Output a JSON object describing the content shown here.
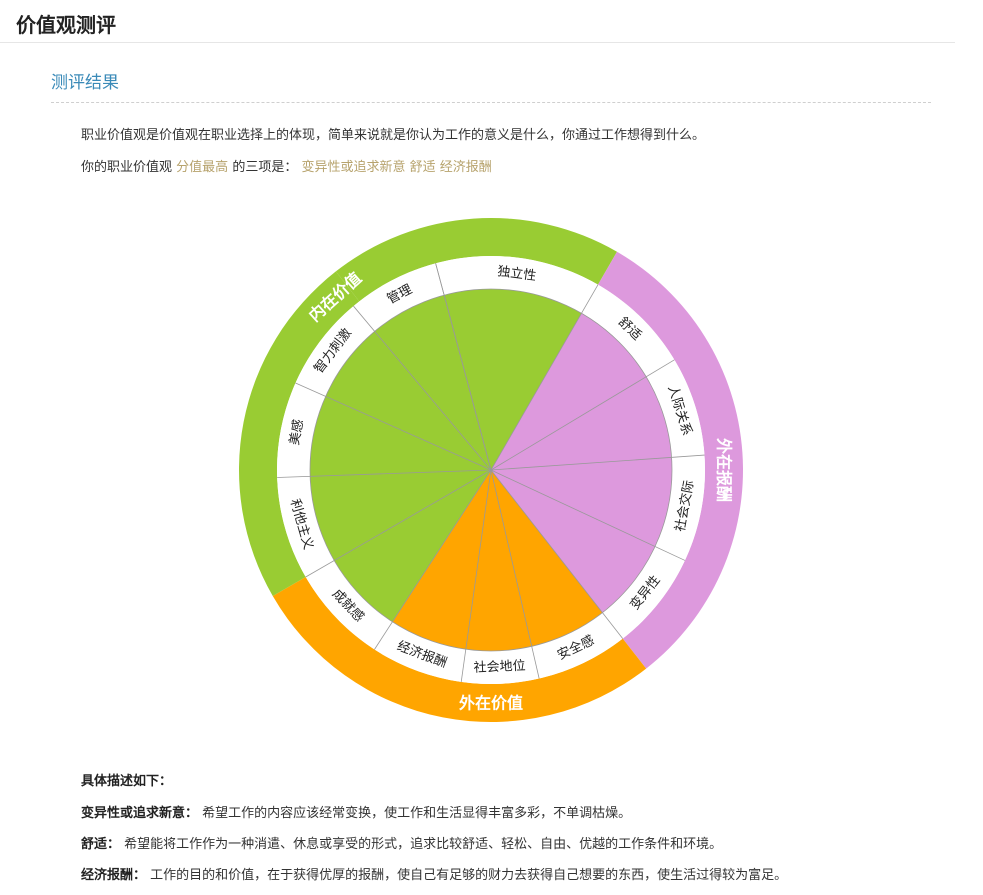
{
  "header": {
    "title": "价值观测评"
  },
  "section": {
    "title": "测评结果"
  },
  "intro": {
    "line1": "职业价值观是价值观在职业选择上的体现，简单来说就是你认为工作的意义是什么，你通过工作想得到什么。",
    "line2_prefix": "你的职业价值观",
    "line2_highlight": "分值最高",
    "line2_middle": "的三项是：",
    "line2_top3": "变异性或追求新意 舒适 经济报酬"
  },
  "wheel": {
    "colors": {
      "intrinsic": "#99cc33",
      "extrinsic_reward": "#dd99dd",
      "extrinsic_value": "#ffa500",
      "divider": "#999999"
    },
    "groups": [
      {
        "name": "内在价值",
        "color": "#99cc33"
      },
      {
        "name": "外在报酬",
        "color": "#dd99dd"
      },
      {
        "name": "外在价值",
        "color": "#ffa500"
      }
    ],
    "items": [
      {
        "label": "独立性",
        "group": 0
      },
      {
        "label": "舒适",
        "group": 1
      },
      {
        "label": "人际关系",
        "group": 1
      },
      {
        "label": "社会交际",
        "group": 1
      },
      {
        "label": "变异性",
        "group": 1
      },
      {
        "label": "安全感",
        "group": 2
      },
      {
        "label": "社会地位",
        "group": 2
      },
      {
        "label": "经济报酬",
        "group": 2
      },
      {
        "label": "成就感",
        "group": 0
      },
      {
        "label": "利他主义",
        "group": 0
      },
      {
        "label": "美感",
        "group": 0
      },
      {
        "label": "智力刺激",
        "group": 0
      },
      {
        "label": "管理",
        "group": 0
      }
    ]
  },
  "details": {
    "heading": "具体描述如下：",
    "rows": [
      {
        "term": "变异性或追求新意：",
        "text": "希望工作的内容应该经常变换，使工作和生活显得丰富多彩，不单调枯燥。"
      },
      {
        "term": "舒适：",
        "text": "希望能将工作作为一种消遣、休息或享受的形式，追求比较舒适、轻松、自由、优越的工作条件和环境。"
      },
      {
        "term": "经济报酬：",
        "text": "工作的目的和价值，在于获得优厚的报酬，使自己有足够的财力去获得自己想要的东西，使生活过得较为富足。"
      }
    ]
  }
}
